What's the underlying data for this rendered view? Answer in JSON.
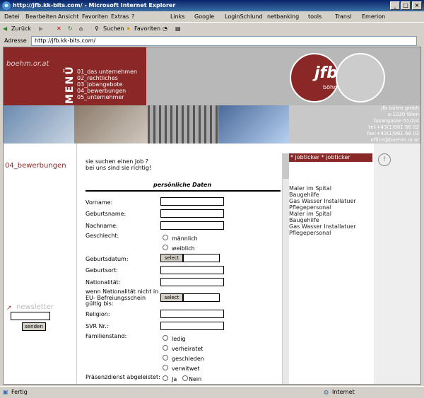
{
  "window": {
    "title": "http://jfb.kk-bits.com/ - Microsoft Internet Explorer"
  },
  "menu": [
    "Datei",
    "Bearbeiten",
    "Ansicht",
    "Favoriten",
    "Extras",
    "?"
  ],
  "links": {
    "label": "Links",
    "items": [
      "Google",
      "LoginSchlund",
      "netbanking",
      "tools",
      "Transl",
      "Emerion"
    ]
  },
  "toolbar": {
    "back": "Zurück",
    "search": "Suchen",
    "favorites": "Favoriten"
  },
  "address": {
    "label": "Adresse",
    "url": "http://jfb.kk-bits.com/"
  },
  "site": {
    "domain_text": "boehm.or.at",
    "menu_word": "MENÜ",
    "nav": [
      "01_das unternehmen",
      "02_rechtliches",
      "03_jobangebote",
      "04_bewerbungen",
      "05_unternehmer"
    ],
    "logo": "jfb",
    "logo_sub": "böhm",
    "contact": [
      "jfb böhm gmbh",
      "a-1030 Wien",
      "fasangasse 51/2/4",
      "tel:+43(1)961 66 02",
      "fax:+43(1)961 66 03",
      "office@boehm.or.at"
    ],
    "section": "04_bewerbungen",
    "newsletter": "newsletter",
    "newsletter_btn": "senden",
    "intro1": "sie suchen einen Job ?",
    "intro2": "bei uns sind sie richtig!",
    "form_title": "persönliche Daten",
    "fields": {
      "vorname": "Vorname:",
      "geburtsname": "Geburtsname:",
      "nachname": "Nachname:",
      "geschlecht": "Geschlecht:",
      "maennlich": "männlich",
      "weiblich": "weiblich",
      "geburtsdatum": "Geburtsdatum:",
      "geburtsort": "Geburtsort:",
      "nationalitaet": "Nationalität:",
      "eu1": "wenn Nationalität nicht in",
      "eu2": "EU- Befreiungsschein",
      "eu3": "gültig bis:",
      "religion": "Religion:",
      "svr": "SVR Nr.:",
      "familienstand": "Familienstand:",
      "ledig": "ledig",
      "verheiratet": "verheiratet",
      "geschieden": "geschieden",
      "verwitwet": "verwitwet",
      "praesenz": "Präsenzdienst abgeleistet:",
      "ja": "Ja",
      "nein": "Nein",
      "select": "select"
    },
    "jobticker_title": "* jobticker * jobticker",
    "jobs": [
      "Maler im Spital",
      "Baugehilfe",
      "Gas Wasser Installatuer",
      "Pflegepersonal",
      "Maler im Spital",
      "Baugehilfe",
      "Gas Wasser Installatuer",
      "Pflegepersonal"
    ]
  },
  "status": {
    "left": "Fertig",
    "right": "Internet"
  }
}
